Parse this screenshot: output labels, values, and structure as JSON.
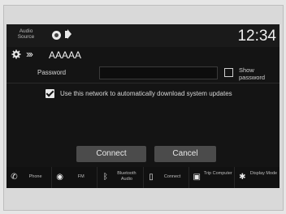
{
  "status_bar": {
    "audio_source_label": "Audio Source",
    "clock": "12:34",
    "icons": [
      "source-badge-icon",
      "speaker-volume-icon"
    ]
  },
  "network": {
    "settings_icon": "gear-icon",
    "breadcrumb_icon": "double-chevron-right-icon",
    "ssid": "AAAAA"
  },
  "password": {
    "label": "Password",
    "value": "",
    "show_label": "Show password",
    "show_checked": false
  },
  "auto_update": {
    "label": "Use this network to automatically download system updates",
    "checked": true
  },
  "actions": {
    "connect_label": "Connect",
    "cancel_label": "Cancel"
  },
  "nav": {
    "items": [
      {
        "icon": "phone-icon",
        "label": "Phone"
      },
      {
        "icon": "fm-radio-icon",
        "label": "FM"
      },
      {
        "icon": "bluetooth-icon",
        "label": "Bluetooth Audio"
      },
      {
        "icon": "smartphone-connect-icon",
        "label": "Connect"
      },
      {
        "icon": "trip-computer-icon",
        "label": "Trip Computer"
      },
      {
        "icon": "display-mode-icon",
        "label": "Display Mode"
      }
    ]
  },
  "colors": {
    "screen_bg": "#141414",
    "button_bg": "#4b4b4b",
    "text": "#d6d6d6"
  }
}
